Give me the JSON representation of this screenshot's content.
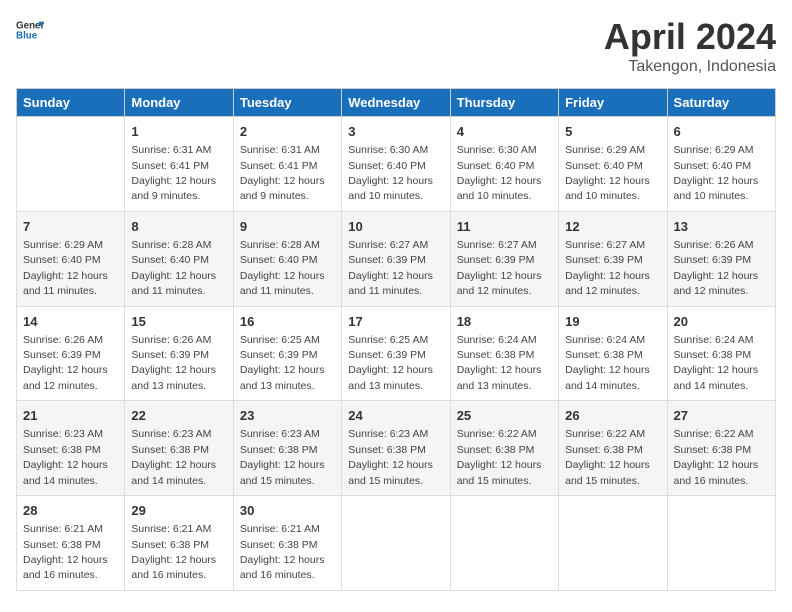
{
  "header": {
    "logo_line1": "General",
    "logo_line2": "Blue",
    "title": "April 2024",
    "subtitle": "Takengon, Indonesia"
  },
  "columns": [
    "Sunday",
    "Monday",
    "Tuesday",
    "Wednesday",
    "Thursday",
    "Friday",
    "Saturday"
  ],
  "weeks": [
    [
      {
        "day": "",
        "sunrise": "",
        "sunset": "",
        "daylight": ""
      },
      {
        "day": "1",
        "sunrise": "Sunrise: 6:31 AM",
        "sunset": "Sunset: 6:41 PM",
        "daylight": "Daylight: 12 hours and 9 minutes."
      },
      {
        "day": "2",
        "sunrise": "Sunrise: 6:31 AM",
        "sunset": "Sunset: 6:41 PM",
        "daylight": "Daylight: 12 hours and 9 minutes."
      },
      {
        "day": "3",
        "sunrise": "Sunrise: 6:30 AM",
        "sunset": "Sunset: 6:40 PM",
        "daylight": "Daylight: 12 hours and 10 minutes."
      },
      {
        "day": "4",
        "sunrise": "Sunrise: 6:30 AM",
        "sunset": "Sunset: 6:40 PM",
        "daylight": "Daylight: 12 hours and 10 minutes."
      },
      {
        "day": "5",
        "sunrise": "Sunrise: 6:29 AM",
        "sunset": "Sunset: 6:40 PM",
        "daylight": "Daylight: 12 hours and 10 minutes."
      },
      {
        "day": "6",
        "sunrise": "Sunrise: 6:29 AM",
        "sunset": "Sunset: 6:40 PM",
        "daylight": "Daylight: 12 hours and 10 minutes."
      }
    ],
    [
      {
        "day": "7",
        "sunrise": "Sunrise: 6:29 AM",
        "sunset": "Sunset: 6:40 PM",
        "daylight": "Daylight: 12 hours and 11 minutes."
      },
      {
        "day": "8",
        "sunrise": "Sunrise: 6:28 AM",
        "sunset": "Sunset: 6:40 PM",
        "daylight": "Daylight: 12 hours and 11 minutes."
      },
      {
        "day": "9",
        "sunrise": "Sunrise: 6:28 AM",
        "sunset": "Sunset: 6:40 PM",
        "daylight": "Daylight: 12 hours and 11 minutes."
      },
      {
        "day": "10",
        "sunrise": "Sunrise: 6:27 AM",
        "sunset": "Sunset: 6:39 PM",
        "daylight": "Daylight: 12 hours and 11 minutes."
      },
      {
        "day": "11",
        "sunrise": "Sunrise: 6:27 AM",
        "sunset": "Sunset: 6:39 PM",
        "daylight": "Daylight: 12 hours and 12 minutes."
      },
      {
        "day": "12",
        "sunrise": "Sunrise: 6:27 AM",
        "sunset": "Sunset: 6:39 PM",
        "daylight": "Daylight: 12 hours and 12 minutes."
      },
      {
        "day": "13",
        "sunrise": "Sunrise: 6:26 AM",
        "sunset": "Sunset: 6:39 PM",
        "daylight": "Daylight: 12 hours and 12 minutes."
      }
    ],
    [
      {
        "day": "14",
        "sunrise": "Sunrise: 6:26 AM",
        "sunset": "Sunset: 6:39 PM",
        "daylight": "Daylight: 12 hours and 12 minutes."
      },
      {
        "day": "15",
        "sunrise": "Sunrise: 6:26 AM",
        "sunset": "Sunset: 6:39 PM",
        "daylight": "Daylight: 12 hours and 13 minutes."
      },
      {
        "day": "16",
        "sunrise": "Sunrise: 6:25 AM",
        "sunset": "Sunset: 6:39 PM",
        "daylight": "Daylight: 12 hours and 13 minutes."
      },
      {
        "day": "17",
        "sunrise": "Sunrise: 6:25 AM",
        "sunset": "Sunset: 6:39 PM",
        "daylight": "Daylight: 12 hours and 13 minutes."
      },
      {
        "day": "18",
        "sunrise": "Sunrise: 6:24 AM",
        "sunset": "Sunset: 6:38 PM",
        "daylight": "Daylight: 12 hours and 13 minutes."
      },
      {
        "day": "19",
        "sunrise": "Sunrise: 6:24 AM",
        "sunset": "Sunset: 6:38 PM",
        "daylight": "Daylight: 12 hours and 14 minutes."
      },
      {
        "day": "20",
        "sunrise": "Sunrise: 6:24 AM",
        "sunset": "Sunset: 6:38 PM",
        "daylight": "Daylight: 12 hours and 14 minutes."
      }
    ],
    [
      {
        "day": "21",
        "sunrise": "Sunrise: 6:23 AM",
        "sunset": "Sunset: 6:38 PM",
        "daylight": "Daylight: 12 hours and 14 minutes."
      },
      {
        "day": "22",
        "sunrise": "Sunrise: 6:23 AM",
        "sunset": "Sunset: 6:38 PM",
        "daylight": "Daylight: 12 hours and 14 minutes."
      },
      {
        "day": "23",
        "sunrise": "Sunrise: 6:23 AM",
        "sunset": "Sunset: 6:38 PM",
        "daylight": "Daylight: 12 hours and 15 minutes."
      },
      {
        "day": "24",
        "sunrise": "Sunrise: 6:23 AM",
        "sunset": "Sunset: 6:38 PM",
        "daylight": "Daylight: 12 hours and 15 minutes."
      },
      {
        "day": "25",
        "sunrise": "Sunrise: 6:22 AM",
        "sunset": "Sunset: 6:38 PM",
        "daylight": "Daylight: 12 hours and 15 minutes."
      },
      {
        "day": "26",
        "sunrise": "Sunrise: 6:22 AM",
        "sunset": "Sunset: 6:38 PM",
        "daylight": "Daylight: 12 hours and 15 minutes."
      },
      {
        "day": "27",
        "sunrise": "Sunrise: 6:22 AM",
        "sunset": "Sunset: 6:38 PM",
        "daylight": "Daylight: 12 hours and 16 minutes."
      }
    ],
    [
      {
        "day": "28",
        "sunrise": "Sunrise: 6:21 AM",
        "sunset": "Sunset: 6:38 PM",
        "daylight": "Daylight: 12 hours and 16 minutes."
      },
      {
        "day": "29",
        "sunrise": "Sunrise: 6:21 AM",
        "sunset": "Sunset: 6:38 PM",
        "daylight": "Daylight: 12 hours and 16 minutes."
      },
      {
        "day": "30",
        "sunrise": "Sunrise: 6:21 AM",
        "sunset": "Sunset: 6:38 PM",
        "daylight": "Daylight: 12 hours and 16 minutes."
      },
      {
        "day": "",
        "sunrise": "",
        "sunset": "",
        "daylight": ""
      },
      {
        "day": "",
        "sunrise": "",
        "sunset": "",
        "daylight": ""
      },
      {
        "day": "",
        "sunrise": "",
        "sunset": "",
        "daylight": ""
      },
      {
        "day": "",
        "sunrise": "",
        "sunset": "",
        "daylight": ""
      }
    ]
  ]
}
